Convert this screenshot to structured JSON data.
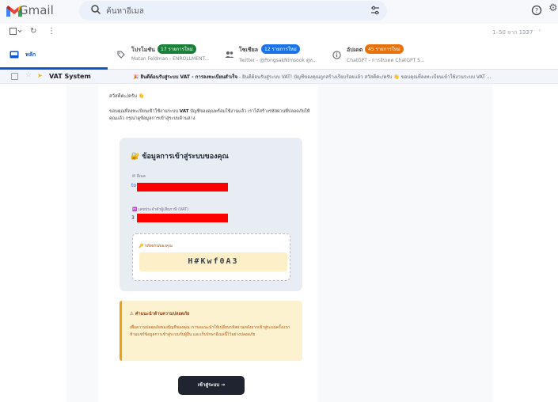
{
  "header": {
    "brand": "Gmail",
    "search_placeholder": "ค้นหาอีเมล"
  },
  "toolbar": {
    "pagination": "1–50 จาก 1337"
  },
  "tabs": {
    "primary_label": "หลัก",
    "promotions": {
      "label": "โปรโมชัน",
      "badge": "17 รายการใหม่",
      "sub": "Matan Feldman - ENROLLMENT...",
      "badge_color": "#188038"
    },
    "social": {
      "label": "โซเชียล",
      "badge": "12 รายการใหม่",
      "sub": "Twitter - @PongsakNimsook ดูท...",
      "badge_color": "#1a73e8"
    },
    "updates": {
      "label": "อัปเดต",
      "badge": "45 รายการใหม่",
      "sub": "ChatGPT - การอัปเดต ChatGPT S...",
      "badge_color": "#e8710a"
    }
  },
  "email": {
    "sender": "VAT System",
    "subject": "🎉 ยินดีต้อนรับสู่ระบบ VAT - การลงทะเบียนสำเร็จ",
    "snippet": " - ยินดีต้อนรับสู่ระบบ VAT! บัญชีของคุณถูกสร้างเรียบร้อยแล้ว สวัสดีค่ะ/ครับ 👋 ขอบคุณที่ลงทะเบียนเข้าใช้งานระบบ VAT ..."
  },
  "message": {
    "greeting": "สวัสดีค่ะ/ครับ 👋",
    "intro_prefix": "ขอบคุณที่ลงทะเบียนเข้าใช้งานระบบ ",
    "intro_bold": "VAT",
    "intro_suffix": " บัญชีของคุณพร้อมใช้งานแล้ว เราได้สร้างรหัสผ่านที่ปลอดภัยให้คุณแล้ว กรุณาดูข้อมูลการเข้าสู่ระบบด้านล่าง",
    "login_title": "🔐 ข้อมูลการเข้าสู่ระบบของคุณ",
    "email_label": "✉ อีเมล",
    "email_prefix": "to",
    "tax_label": "🆔 เลขประจำตัวผู้เสียภาษี (VAT)",
    "tax_prefix": "3",
    "password_label": "🔑 รหัสผ่านของคุณ",
    "password_value": "H#Kwf0A3",
    "warning_title": "⚠ คำแนะนำด้านความปลอดภัย",
    "warning_text": "เพื่อความปลอดภัยของบัญชีของคุณ เราขอแนะนำให้เปลี่ยนรหัสผ่านหลังจากเข้าสู่ระบบครั้งแรก ห้ามแชร์ข้อมูลการเข้าสู่ระบบกับผู้อื่น และเก็บรักษาอีเมลนี้ไว้อย่างปลอดภัย",
    "cta_label": "เข้าสู่ระบบ →"
  }
}
